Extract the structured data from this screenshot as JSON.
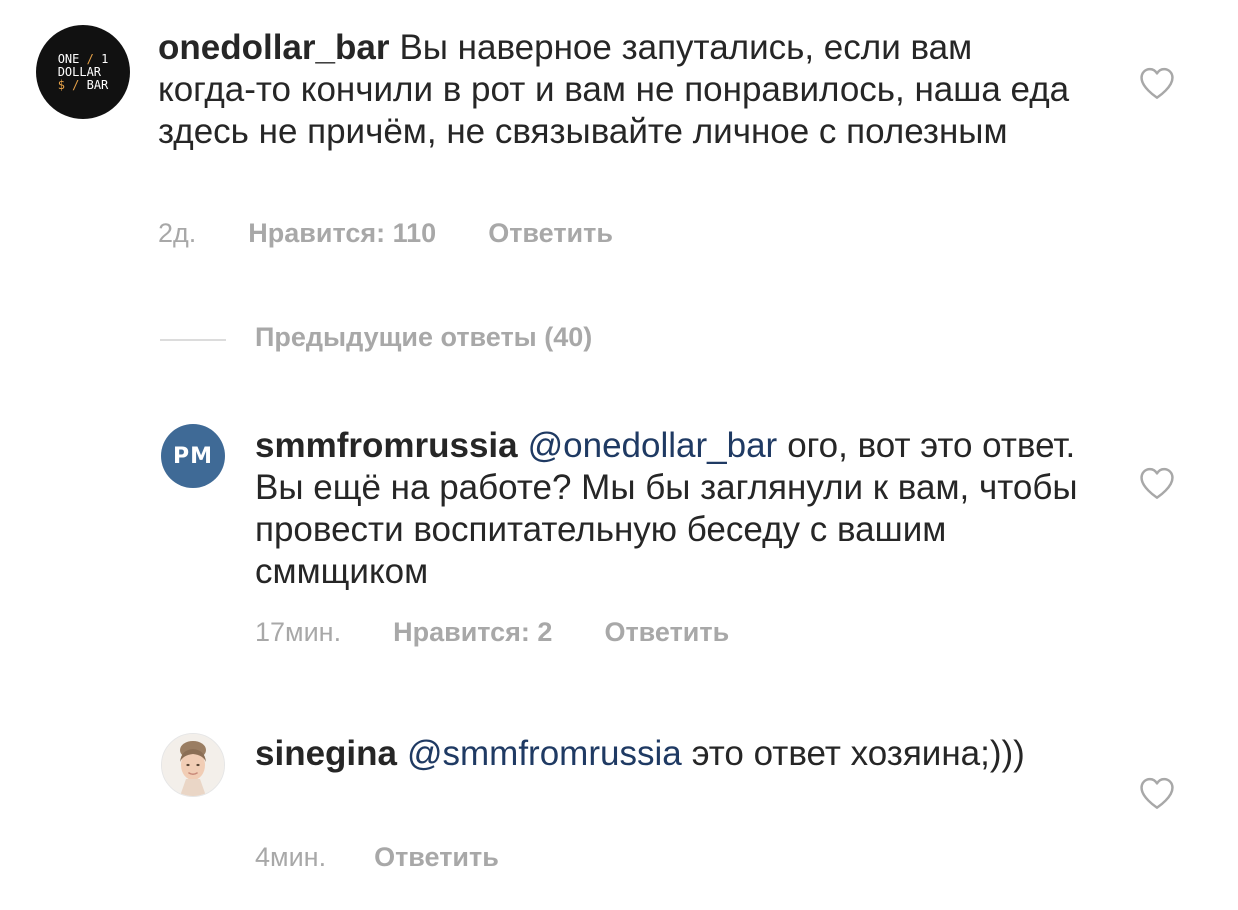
{
  "comments": [
    {
      "username": "onedollar_bar",
      "mention": "",
      "text": "Вы наверное запутались, если вам когда-то кончили в рот и вам не понравилось, наша еда здесь не причём, не связывайте личное с полезным",
      "time": "2д.",
      "likes": "Нравится: 110",
      "reply": "Ответить",
      "avatar_lines": [
        "ONE",
        "DOLLAR",
        "BAR"
      ],
      "avatar_numerals": [
        "1",
        "$"
      ]
    },
    {
      "username": "smmfromrussia",
      "mention": "@onedollar_bar",
      "text": "ого, вот это ответ. Вы ещё на работе? Мы бы заглянули к вам, чтобы провести воспитательную беседу с вашим сммщиком",
      "time": "17мин.",
      "likes": "Нравится: 2",
      "reply": "Ответить",
      "avatar_initials": "PM"
    },
    {
      "username": "sinegina",
      "mention": "@smmfromrussia",
      "text": "это ответ хозяина;)))",
      "time": "4мин.",
      "likes": "",
      "reply": "Ответить"
    }
  ],
  "previous_replies": "Предыдущие ответы (40)",
  "icons": {
    "like": "heart-outline-icon"
  },
  "colors": {
    "text": "#262626",
    "meta": "#a8a8a8",
    "mention": "#1f3a63",
    "pm_avatar": "#3f6a96"
  }
}
